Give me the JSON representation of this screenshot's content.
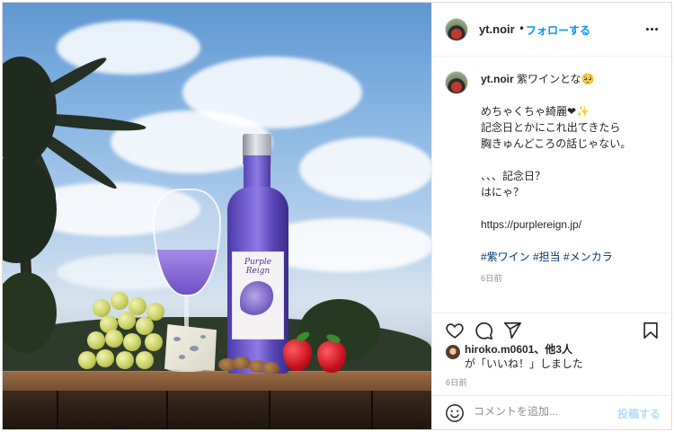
{
  "post": {
    "author": {
      "username": "yt.noir",
      "separator": "•",
      "follow_label": "フォローする"
    },
    "photo": {
      "bottle_label_text": "Purple Reign"
    },
    "caption": {
      "username": "yt.noir",
      "lines": [
        "紫ワインとな🥺",
        "めちゃくちゃ綺麗❤︎✨",
        "記念日とかにこれ出てきたら",
        "胸きゅんどころの話じゃない。",
        "",
        "、、、記念日？",
        "はにゃ？",
        "",
        "https://purplereign.jp/",
        "",
        "#紫ワイン #担当 #メンカラ"
      ],
      "timestamp": "6日前"
    },
    "actions": {
      "icons": [
        "heart-icon",
        "comment-icon",
        "share-icon",
        "bookmark-icon"
      ]
    },
    "likes": {
      "liker": "hiroko.m0601",
      "others": "、他3人",
      "suffix": "が「いいね！」しました"
    },
    "timestamp": "6日前",
    "comment": {
      "placeholder": "コメントを追加...",
      "post_label": "投稿する"
    }
  }
}
